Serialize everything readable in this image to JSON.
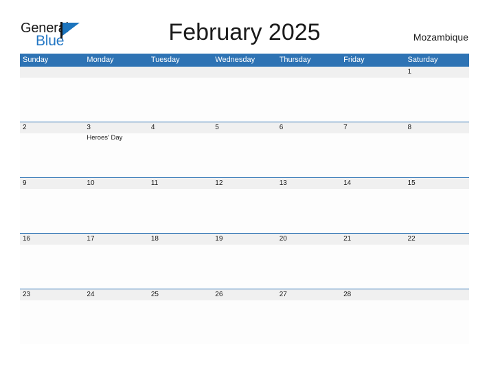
{
  "logo": {
    "word_one": "General",
    "word_two": "Blue",
    "flag_icon": "flag-pennant-icon",
    "accent_color": "#1b74bd"
  },
  "header": {
    "title": "February 2025",
    "country": "Mozambique"
  },
  "colors": {
    "header_blue": "#2e73b4",
    "date_band_gray": "#f0f0f0",
    "cell_white": "#fdfdfd",
    "text_dark": "#1a1a1a",
    "logo_blue": "#2276c4"
  },
  "calendar": {
    "month": "February",
    "year": "2025",
    "weekday_headers": [
      "Sunday",
      "Monday",
      "Tuesday",
      "Wednesday",
      "Thursday",
      "Friday",
      "Saturday"
    ],
    "weeks": [
      [
        {
          "day": "",
          "event": ""
        },
        {
          "day": "",
          "event": ""
        },
        {
          "day": "",
          "event": ""
        },
        {
          "day": "",
          "event": ""
        },
        {
          "day": "",
          "event": ""
        },
        {
          "day": "",
          "event": ""
        },
        {
          "day": "1",
          "event": ""
        }
      ],
      [
        {
          "day": "2",
          "event": ""
        },
        {
          "day": "3",
          "event": "Heroes' Day"
        },
        {
          "day": "4",
          "event": ""
        },
        {
          "day": "5",
          "event": ""
        },
        {
          "day": "6",
          "event": ""
        },
        {
          "day": "7",
          "event": ""
        },
        {
          "day": "8",
          "event": ""
        }
      ],
      [
        {
          "day": "9",
          "event": ""
        },
        {
          "day": "10",
          "event": ""
        },
        {
          "day": "11",
          "event": ""
        },
        {
          "day": "12",
          "event": ""
        },
        {
          "day": "13",
          "event": ""
        },
        {
          "day": "14",
          "event": ""
        },
        {
          "day": "15",
          "event": ""
        }
      ],
      [
        {
          "day": "16",
          "event": ""
        },
        {
          "day": "17",
          "event": ""
        },
        {
          "day": "18",
          "event": ""
        },
        {
          "day": "19",
          "event": ""
        },
        {
          "day": "20",
          "event": ""
        },
        {
          "day": "21",
          "event": ""
        },
        {
          "day": "22",
          "event": ""
        }
      ],
      [
        {
          "day": "23",
          "event": ""
        },
        {
          "day": "24",
          "event": ""
        },
        {
          "day": "25",
          "event": ""
        },
        {
          "day": "26",
          "event": ""
        },
        {
          "day": "27",
          "event": ""
        },
        {
          "day": "28",
          "event": ""
        },
        {
          "day": "",
          "event": ""
        }
      ]
    ]
  }
}
